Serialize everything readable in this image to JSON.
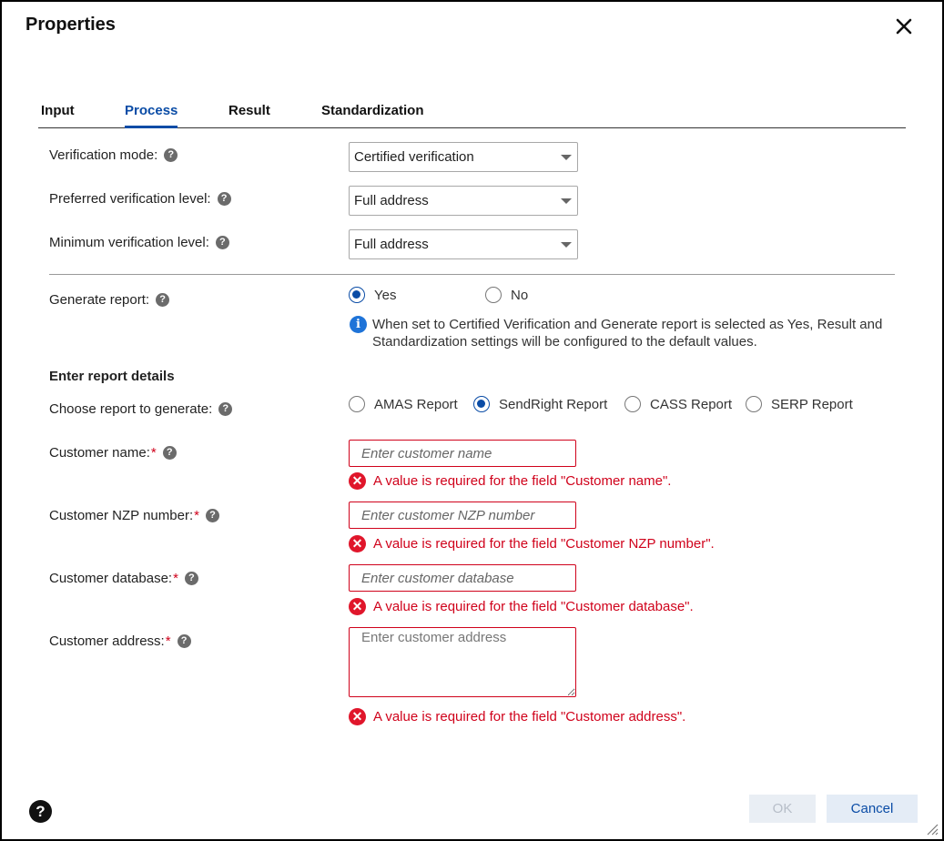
{
  "dialog": {
    "title": "Properties"
  },
  "tabs": [
    {
      "label": "Input",
      "active": false
    },
    {
      "label": "Process",
      "active": true
    },
    {
      "label": "Result",
      "active": false
    },
    {
      "label": "Standardization",
      "active": false
    }
  ],
  "verification": {
    "mode_label": "Verification mode:",
    "mode_value": "Certified verification",
    "preferred_label": "Preferred verification level:",
    "preferred_value": "Full address",
    "minimum_label": "Minimum verification level:",
    "minimum_value": "Full address"
  },
  "report": {
    "generate_label": "Generate report:",
    "yes_label": "Yes",
    "no_label": "No",
    "selected": "Yes",
    "info_text": "When set to Certified Verification and Generate report is selected as Yes, Result and Standardization settings will be configured to the default values.",
    "section_heading": "Enter report details",
    "choose_label": "Choose report to generate:",
    "options": [
      "AMAS Report",
      "SendRight Report",
      "CASS Report",
      "SERP Report"
    ],
    "selected_option": "SendRight Report"
  },
  "fields": {
    "customer_name": {
      "label": "Customer name:",
      "required_mark": "*",
      "placeholder": "Enter customer name",
      "error": "A value is required for the field \"Customer name\"."
    },
    "customer_nzp": {
      "label": "Customer NZP number:",
      "required_mark": "*",
      "placeholder": "Enter customer NZP number",
      "error": "A value is required for the field \"Customer NZP number\"."
    },
    "customer_database": {
      "label": "Customer database:",
      "required_mark": "*",
      "placeholder": "Enter customer database",
      "error": "A value is required for the field \"Customer database\"."
    },
    "customer_address": {
      "label": "Customer address:",
      "required_mark": "*",
      "placeholder": "Enter customer address",
      "error": "A value is required for the field \"Customer address\"."
    }
  },
  "footer": {
    "ok_label": "OK",
    "cancel_label": "Cancel"
  },
  "colors": {
    "accent": "#0a4ca6",
    "error": "#d0021b",
    "info": "#1e73d8"
  }
}
